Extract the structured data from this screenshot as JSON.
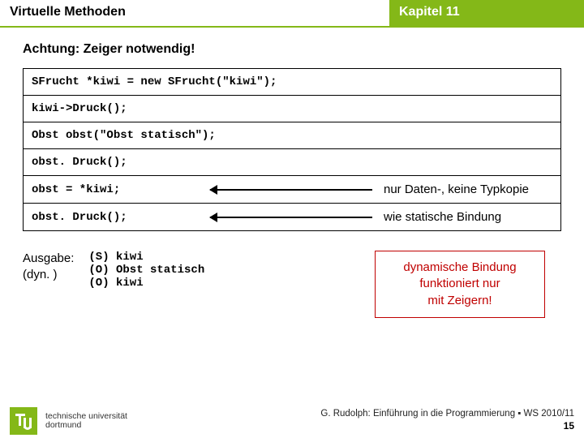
{
  "header": {
    "title": "Virtuelle Methoden",
    "chapter": "Kapitel 11"
  },
  "warning": "Achtung: Zeiger notwendig!",
  "code": {
    "r1": "SFrucht *kiwi = new SFrucht(\"kiwi\");",
    "r2": "kiwi->Druck();",
    "r3": "Obst obst(\"Obst statisch\");",
    "r4": "obst. Druck();",
    "r5": "obst = *kiwi;",
    "r6": "obst. Druck();"
  },
  "annotations": {
    "a5": "nur Daten-, keine Typkopie",
    "a6": "wie statische Bindung"
  },
  "output": {
    "label1": "Ausgabe:",
    "label2": "(dyn. )",
    "lines": "(S) kiwi\n(O) Obst statisch\n(O) kiwi"
  },
  "callout": {
    "l1": "dynamische Bindung",
    "l2": "funktioniert nur",
    "l3": "mit Zeigern!"
  },
  "footer": {
    "credit": "G. Rudolph: Einführung in die Programmierung ▪ WS 2010/11",
    "page": "15",
    "uni1": "technische universität",
    "uni2": "dortmund"
  }
}
